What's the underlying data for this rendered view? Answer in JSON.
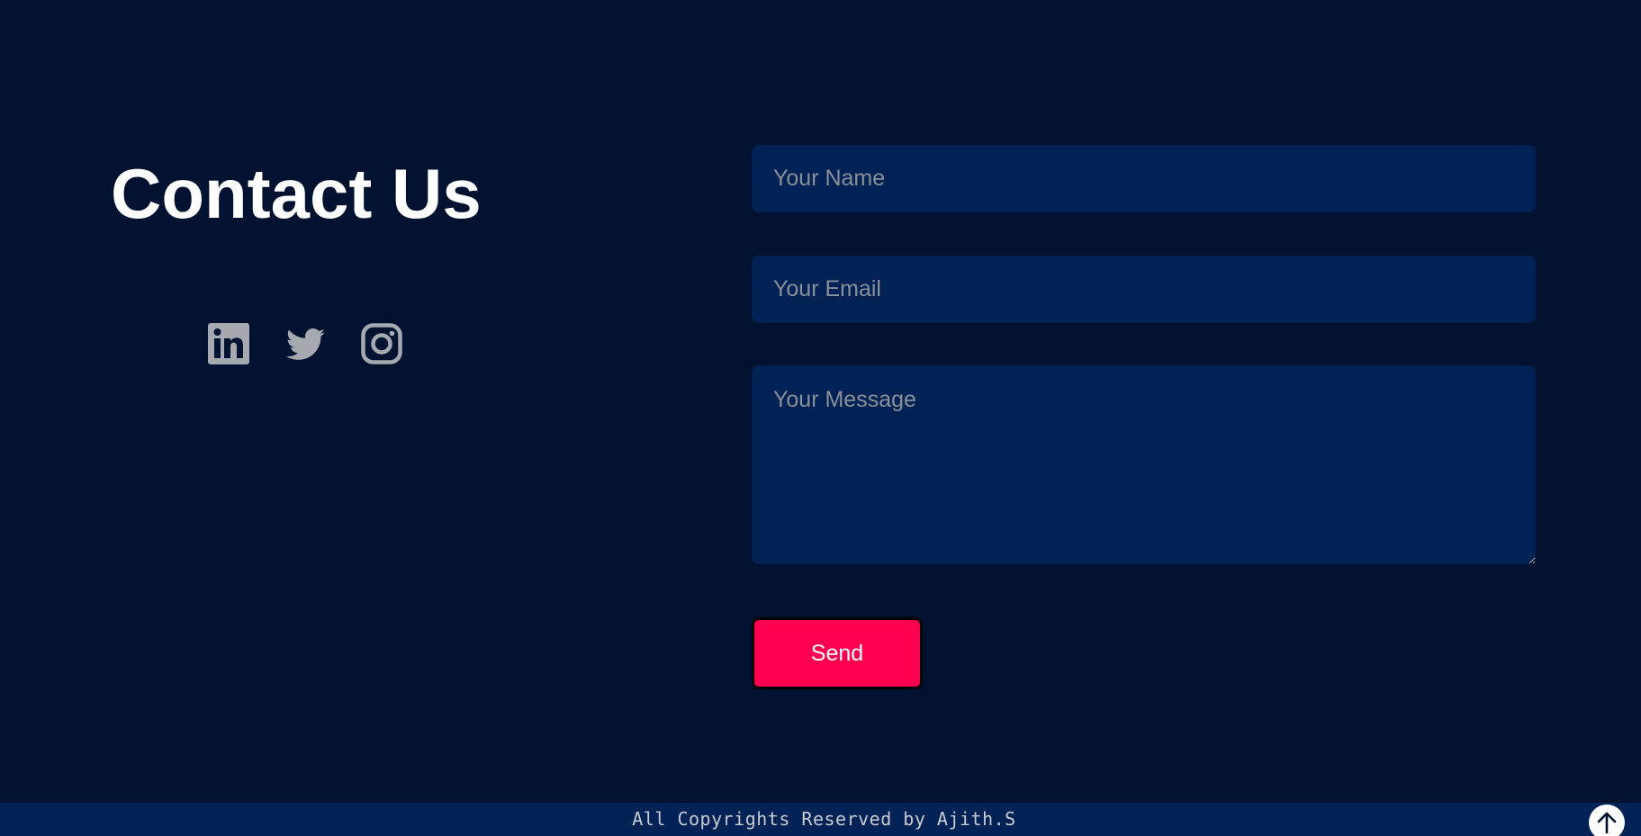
{
  "heading": "Contact Us",
  "social": [
    {
      "name": "linkedin-icon"
    },
    {
      "name": "twitter-icon"
    },
    {
      "name": "instagram-icon"
    }
  ],
  "form": {
    "name_placeholder": "Your Name",
    "email_placeholder": "Your Email",
    "message_placeholder": "Your Message",
    "send_label": "Send"
  },
  "footer": {
    "text": "All Copyrights Reserved by Ajith.S"
  },
  "colors": {
    "background": "#001230",
    "field": "#002254",
    "accent": "#ff0050",
    "icon": "#a6a9b0"
  },
  "scroll_top_icon": "arrow-up-icon"
}
